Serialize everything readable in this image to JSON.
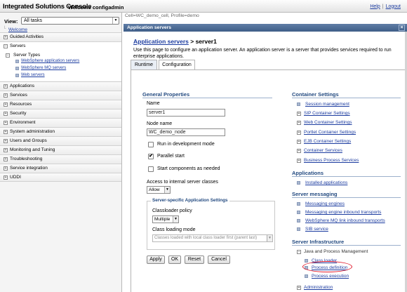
{
  "header": {
    "brand": "Integrated Solutions Console",
    "welcome": "Welcome configadmin",
    "help": "Help",
    "separator": "|",
    "logout": "Logout"
  },
  "nav": {
    "view_label": "View:",
    "view_value": "All tasks",
    "welcome_link": "Welcome",
    "items": [
      "Guided Activities",
      "Servers",
      "Applications",
      "Services",
      "Resources",
      "Security",
      "Environment",
      "System administration",
      "Users and Groups",
      "Monitoring and Tuning",
      "Troubleshooting",
      "Service integration",
      "UDDI"
    ],
    "servers_sub": {
      "title": "Server Types",
      "links": [
        "WebSphere application servers",
        "WebSphere MQ servers",
        "Web servers"
      ]
    }
  },
  "cell_info": "Cell=WC_demo_cell, Profile=demo",
  "portlet_title": "Application servers",
  "close_glyph": "×",
  "breadcrumb": {
    "link": "Application servers",
    "separator": " > ",
    "current": "server1"
  },
  "description": "Use this page to configure an application server. An application server is a server that provides services required to run enterprise applications.",
  "tabs": [
    "Runtime",
    "Configuration"
  ],
  "general": {
    "heading": "General Properties",
    "name_label": "Name",
    "name_value": "server1",
    "node_label": "Node name",
    "node_value": "WC_demo_node",
    "dev_mode": "Run in development mode",
    "parallel_start": "Parallel start",
    "start_components": "Start components as needed",
    "access_label": "Access to internal server classes",
    "access_value": "Allow",
    "fieldset_title": "Server-specific Application Settings",
    "classloader_label": "Classloader policy",
    "classloader_value": "Multiple",
    "class_loading_label": "Class loading mode",
    "class_loading_value": "Classes loaded with local class loader first (parent last)",
    "check_mark": "✔"
  },
  "buttons": [
    "Apply",
    "OK",
    "Reset",
    "Cancel"
  ],
  "right": {
    "container_heading": "Container Settings",
    "session_management": "Session management",
    "container_items": [
      "SIP Container Settings",
      "Web Container Settings",
      "Portlet Container Settings",
      "EJB Container Settings",
      "Container Services",
      "Business Process Services"
    ],
    "applications_heading": "Applications",
    "installed_applications": "Installed applications",
    "messaging_heading": "Server messaging",
    "messaging_links": [
      "Messaging engines",
      "Messaging engine inbound transports",
      "WebSphere MQ link inbound transports",
      "SIB service"
    ],
    "infra_heading": "Server Infrastructure",
    "java_pm": "Java and Process Management",
    "java_links": [
      "Class loader",
      "Process definition",
      "Process execution"
    ],
    "administration": "Administration"
  },
  "colors": {
    "portlet_bar": "#4a6a95",
    "heading_blue": "#234a80",
    "link_blue": "#1c3ca0",
    "highlight_circle": "#e0182a"
  }
}
